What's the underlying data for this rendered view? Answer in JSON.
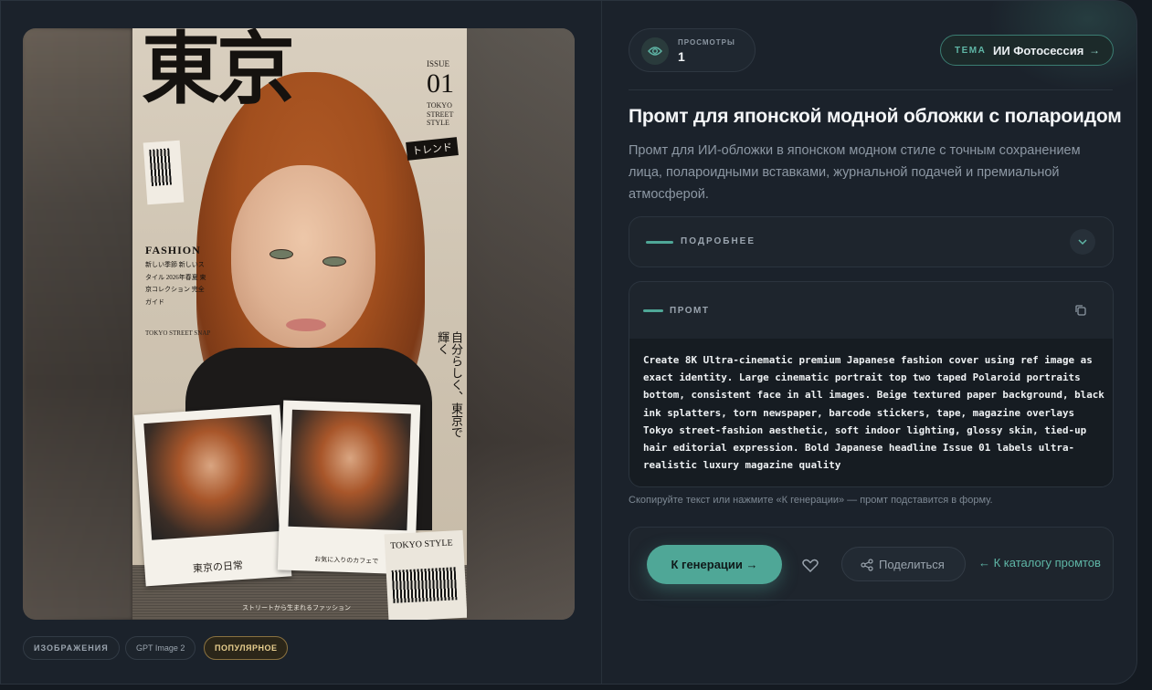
{
  "cover": {
    "kanji": "東京",
    "issue_label": "ISSUE",
    "issue_number": "01",
    "issue_sub": "TOKYO STREET STYLE",
    "trend": "トレンド",
    "fashion_title": "FASHION",
    "fashion_lines": "新しい季節 新しいスタイル 2026年春夏 東京コレクション 完全ガイド",
    "tokyo_snap": "TOKYO STREET SNAP",
    "vertical_text": "自分らしく、東京で輝く",
    "polaroid1_caption": "東京の日常",
    "polaroid2_caption": "お気に入りのカフェで",
    "tokyo_style": "TOKYO STYLE",
    "bottom_strip": "ストリートから生まれるファッション"
  },
  "tags": [
    "ИЗОБРАЖЕНИЯ",
    "GPT Image 2",
    "ПОПУЛЯРНОЕ"
  ],
  "views": {
    "label": "ПРОСМОТРЫ",
    "value": "1"
  },
  "theme": {
    "key": "ТЕМА",
    "value": "ИИ Фотосессия",
    "arrow": "→"
  },
  "title": "Промт для японской модной обложки с полароидом",
  "description": "Промт для ИИ-обложки в японском модном стиле с точным сохранением лица, полароидными вставками, журнальной подачей и премиальной атмосферой.",
  "details_label": "ПОДРОБНЕЕ",
  "prompt": {
    "label": "ПРОМТ",
    "text": "Create 8K Ultra-cinematic premium Japanese fashion cover using ref image as exact identity. Large cinematic portrait top two taped Polaroid portraits bottom, consistent face in all images. Beige textured paper background, black ink splatters, torn newspaper, barcode stickers, tape, magazine overlays Tokyo street-fashion aesthetic, soft indoor lighting, glossy skin, tied-up hair editorial expression. Bold Japanese headline Issue 01 labels ultra-realistic luxury magazine quality"
  },
  "hint": "Скопируйте текст или нажмите «К генерации» — промт подставится в форму.",
  "actions": {
    "generate": "К генерации →",
    "share": "Поделиться",
    "back": "← К каталогу промтов"
  },
  "colors": {
    "accent": "#4fa797",
    "background": "#1b222b",
    "popular": "#e8cf8f"
  }
}
